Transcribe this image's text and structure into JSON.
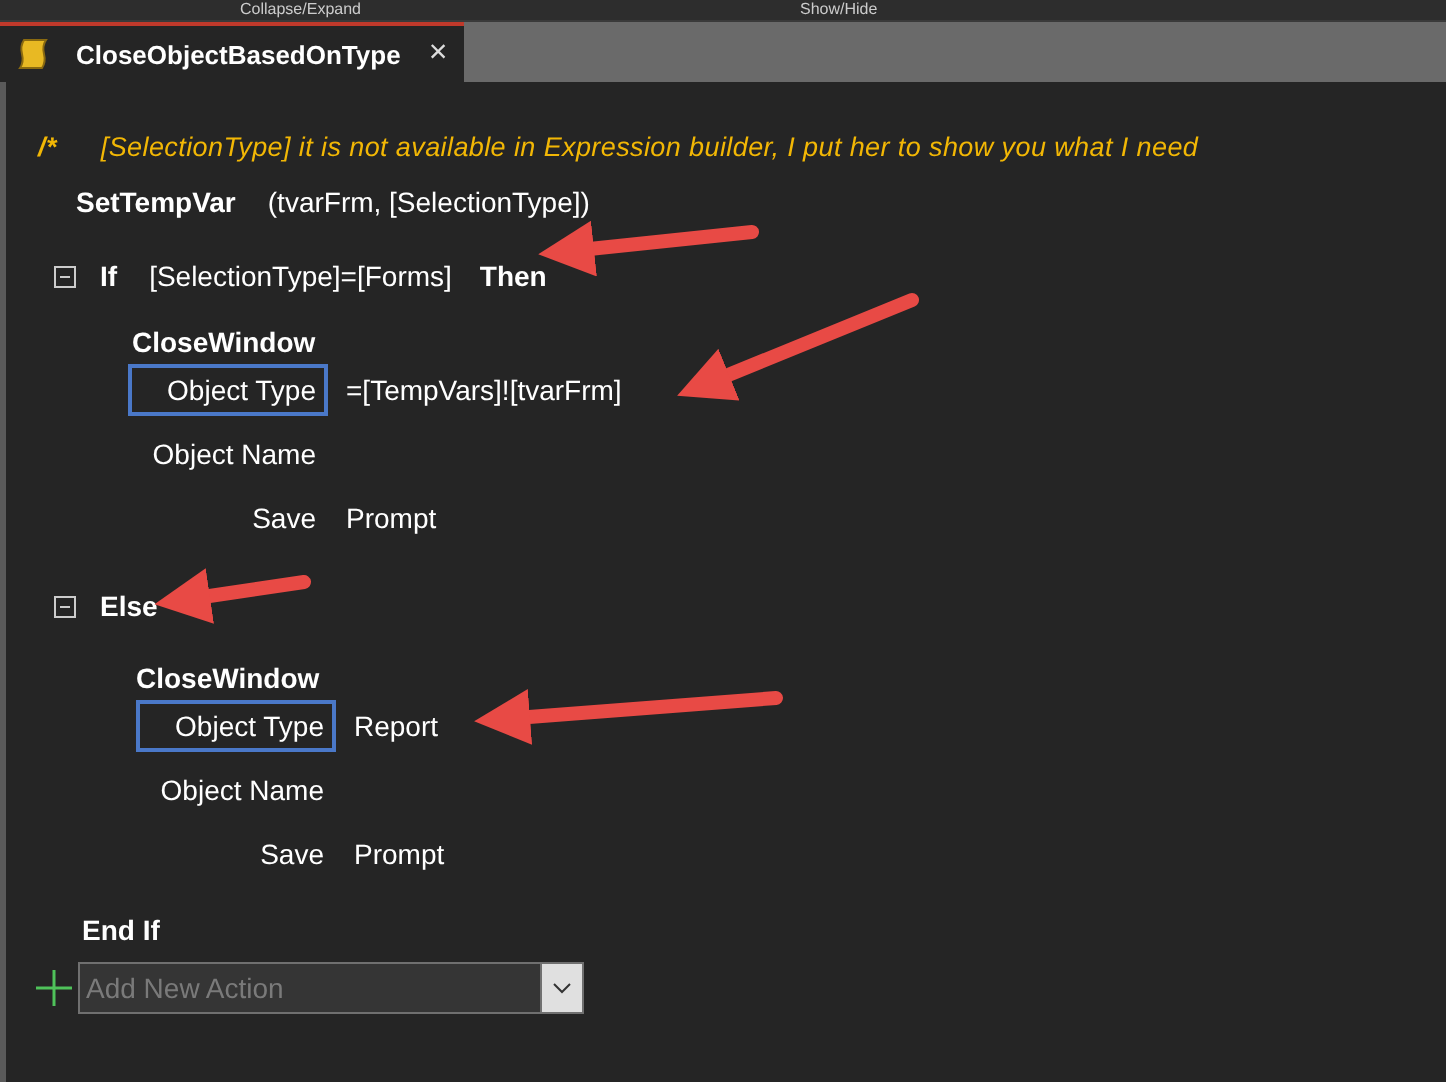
{
  "ribbon": {
    "labels": [
      "Collapse/Expand",
      "Show/Hide"
    ]
  },
  "tab": {
    "title": "CloseObjectBasedOnType",
    "selected": true,
    "close": "×"
  },
  "comment": {
    "marker": "/*",
    "text": "[SelectionType] it is not available in Expression builder, I put her to show you what I need"
  },
  "set_temp_var": {
    "action": "SetTempVar",
    "args": "(tvarFrm, [SelectionType])"
  },
  "if_block": {
    "keyword": "If",
    "condition": "[SelectionType]=[Forms]",
    "then": "Then",
    "expanded": true,
    "action": {
      "name": "CloseWindow",
      "arguments": [
        {
          "label": "Object Type",
          "value": "=[TempVars]![tvarFrm]",
          "highlighted": true
        },
        {
          "label": "Object Name",
          "highlighted": false
        },
        {
          "label": "Save",
          "value": "Prompt",
          "highlighted": false
        }
      ]
    }
  },
  "else_block": {
    "keyword": "Else",
    "expanded": true,
    "action": {
      "name": "CloseWindow",
      "arguments": [
        {
          "label": "Object Type",
          "value": "Report",
          "highlighted": true
        },
        {
          "label": "Object Name",
          "highlighted": false
        },
        {
          "label": "Save",
          "value": "Prompt",
          "highlighted": false
        }
      ]
    }
  },
  "end_if": "End If",
  "add_action": {
    "placeholder": "Add New Action"
  }
}
